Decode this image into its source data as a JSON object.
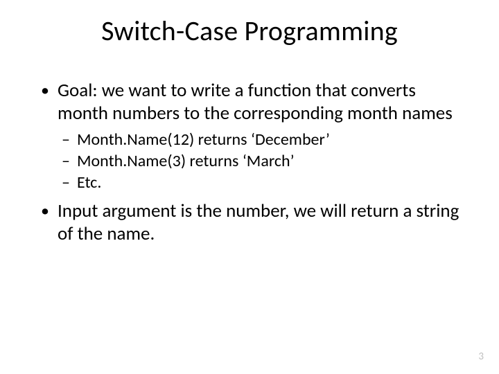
{
  "title": "Switch-Case Programming",
  "bullets": {
    "b1": "Goal: we want to write a function that converts month numbers to the corresponding month names",
    "b1_sub": {
      "s1": "Month.Name(12) returns ‘December’",
      "s2": "Month.Name(3) returns ‘March’",
      "s3": "Etc."
    },
    "b2": "Input argument is the number, we will return a string of the name."
  },
  "page_number": "3"
}
